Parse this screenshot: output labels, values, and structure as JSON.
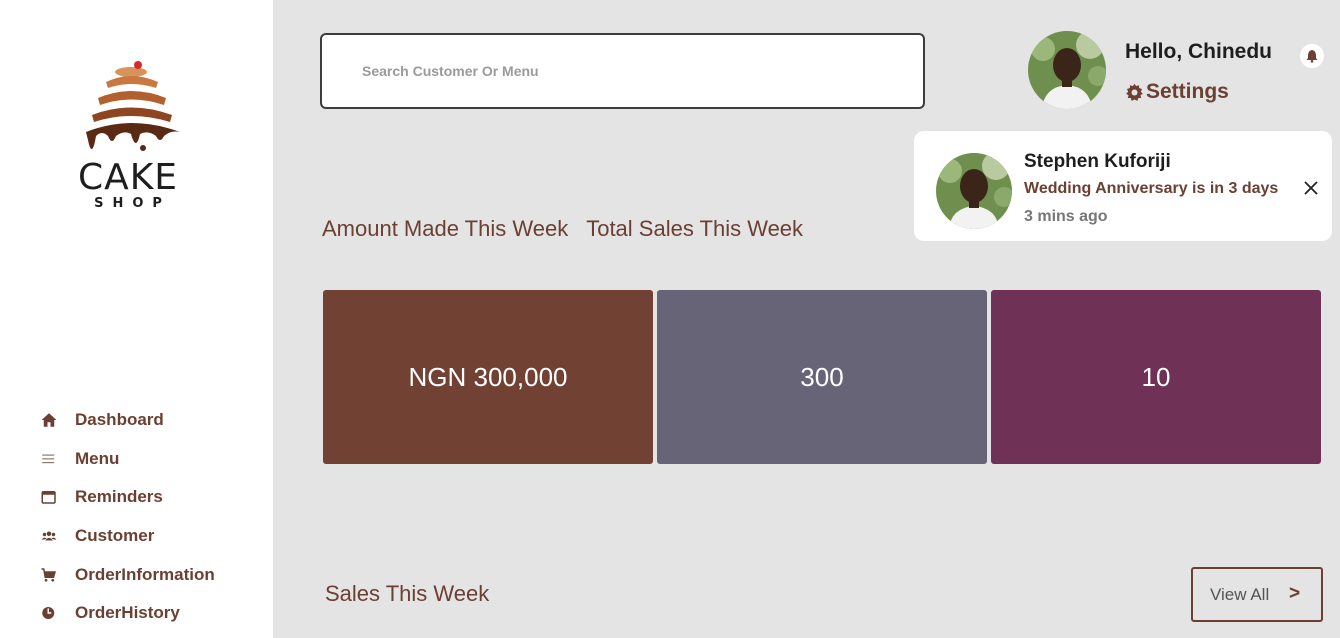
{
  "brand": {
    "wordmark": "CAKE",
    "tagline": "SHOP",
    "colors": {
      "brown": "#714233",
      "slate": "#666476",
      "plum": "#703156",
      "text_brown": "#6b4033",
      "background": "#e4e4e4"
    }
  },
  "sidebar": {
    "items": [
      {
        "label": "Dashboard",
        "icon": "home-icon"
      },
      {
        "label": "Menu",
        "icon": "menu-icon"
      },
      {
        "label": "Reminders",
        "icon": "calendar-icon"
      },
      {
        "label": "Customer",
        "icon": "users-icon"
      },
      {
        "label": "OrderInformation",
        "icon": "cart-icon"
      },
      {
        "label": "OrderHistory",
        "icon": "clock-icon"
      }
    ]
  },
  "search": {
    "placeholder": "Search Customer Or Menu",
    "value": ""
  },
  "header": {
    "greeting": "Hello, Chinedu",
    "settings_label": "Settings",
    "bell_icon": "bell-icon",
    "settings_icon": "gear-icon"
  },
  "notification": {
    "name": "Stephen Kuforiji",
    "message": "Wedding Anniversary is in 3 days",
    "time": "3 mins ago",
    "close_icon": "close-icon"
  },
  "overview": {
    "amount_title": "Amount Made This Week",
    "sales_title": "Total Sales This Week",
    "cards": [
      "NGN 300,000",
      "300",
      "10"
    ]
  },
  "sales": {
    "title": "Sales This Week",
    "view_all_label": "View All",
    "view_all_icon": "chevron-right-icon",
    "chevron_glyph": ">"
  }
}
